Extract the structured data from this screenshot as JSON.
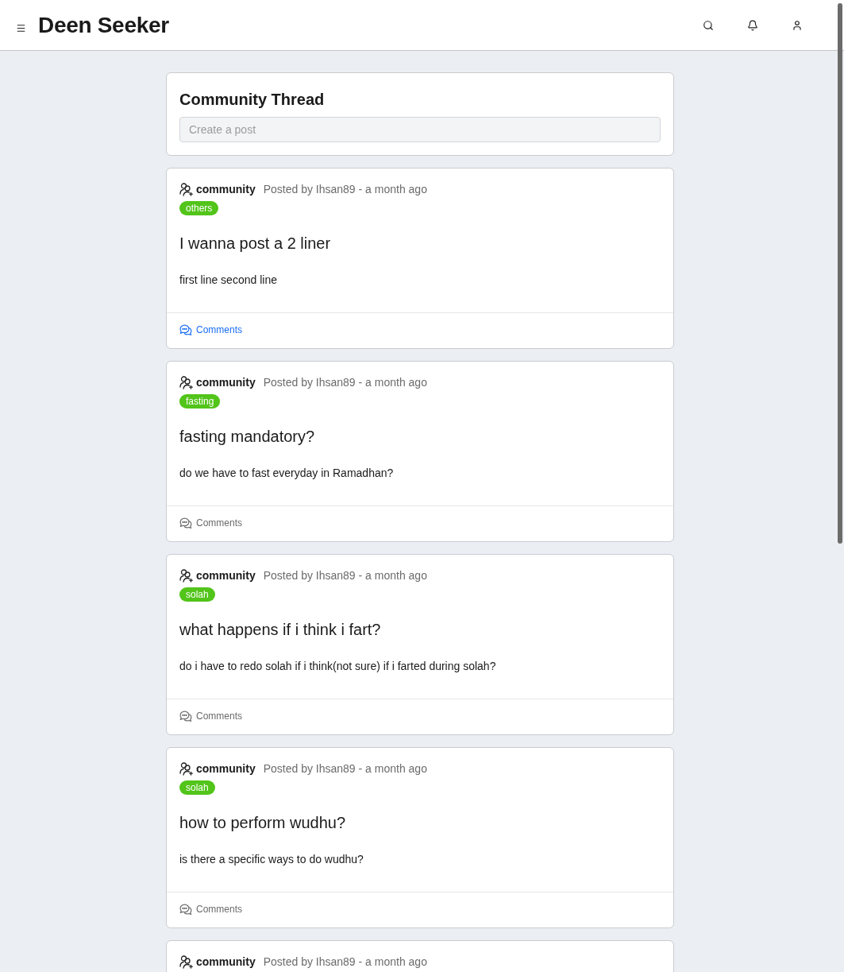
{
  "header": {
    "title": "Deen Seeker"
  },
  "composer": {
    "title": "Community Thread",
    "placeholder": "Create a post"
  },
  "posts": [
    {
      "community": "community",
      "meta": "Posted by Ihsan89 - a month ago",
      "tag": "others",
      "title": "I wanna post a 2 liner",
      "body": "first line second line",
      "comments": {
        "label": "Comments",
        "active": true
      }
    },
    {
      "community": "community",
      "meta": "Posted by Ihsan89 - a month ago",
      "tag": "fasting",
      "title": "fasting mandatory?",
      "body": "do we have to fast everyday in Ramadhan?",
      "comments": {
        "label": "Comments",
        "active": false
      }
    },
    {
      "community": "community",
      "meta": "Posted by Ihsan89 - a month ago",
      "tag": "solah",
      "title": "what happens if i think i fart?",
      "body": "do i have to redo solah if i think(not sure) if i farted during solah?",
      "comments": {
        "label": "Comments",
        "active": false
      }
    },
    {
      "community": "community",
      "meta": "Posted by Ihsan89 - a month ago",
      "tag": "solah",
      "title": "how to perform wudhu?",
      "body": "is there a specific ways to do wudhu?",
      "comments": {
        "label": "Comments",
        "active": false
      }
    },
    {
      "community": "community",
      "meta": "Posted by Ihsan89 - a month ago"
    }
  ]
}
